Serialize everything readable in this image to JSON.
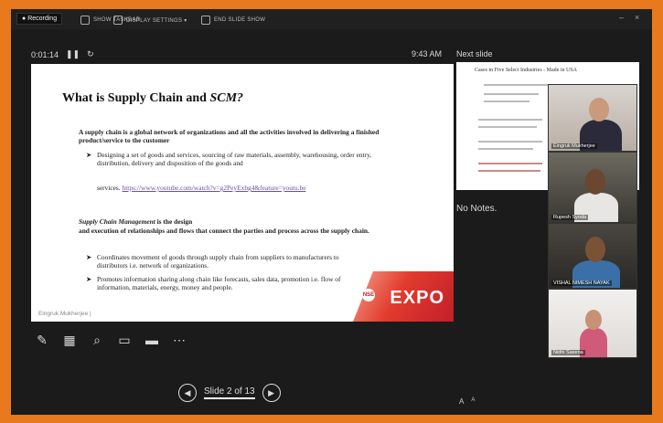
{
  "topbar": {
    "recording_label": "Recording",
    "items": [
      "SHOW TASKBAR",
      "DISPLAY SETTINGS ▾",
      "END SLIDE SHOW"
    ],
    "window_controls": [
      "–",
      "×"
    ]
  },
  "presenter": {
    "elapsed": "0:01:14",
    "clock": "9:43 AM",
    "next_slide_label": "Next slide",
    "notes_label": "No Notes.",
    "slide_counter": "Slide 2 of 13",
    "font_controls": [
      "A",
      "A"
    ]
  },
  "slide": {
    "title_plain": "What is Supply Chain and ",
    "title_italic": "SCM?",
    "p1": "A supply chain is a global network of organizations and all the activities involved in delivering a finished product/service to the customer",
    "b1": "Designing a set of goods and services, sourcing of raw materials, assembly, warehousing, order entry, distribution, delivery and disposition of the goods and",
    "b1_tail": "services.",
    "b1_link": "https://www.youtube.com/watch?v=g2PeyExbg4&feature=youtu.be",
    "p2_a": "Supply Chain Management",
    "p2_b": " is the design",
    "p2_c": "and execution of relationships and flows that connect the parties and process across the supply chain.",
    "b2": "Coordinates movement of goods through supply chain from suppliers to manufacturers to distributors i.e. network of organizations.",
    "b3": "Promotes information sharing along chain like forecasts, sales data, promotion i.e. flow of information, materials, energy, money and people.",
    "author": "Eingruk Mukherjee |",
    "expo_badge": "NSE",
    "expo_text": "EXPO"
  },
  "next_slide": {
    "title": "Cases in Five Select Industries - Made in USA"
  },
  "participants": [
    {
      "name": "Eingruk Mukherjee"
    },
    {
      "name": "Rupesh Syoda"
    },
    {
      "name": "VISHAL NIMESH NAYAK"
    },
    {
      "name": "Nidhi Saxena"
    }
  ],
  "colors": {
    "border": "#e8791c",
    "background": "#1b1b1b",
    "expo_red": "#c21f2a"
  }
}
